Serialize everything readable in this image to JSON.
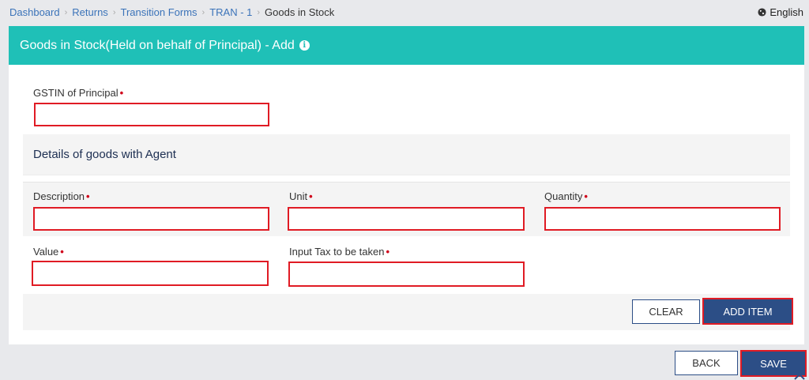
{
  "breadcrumb": {
    "items": [
      "Dashboard",
      "Returns",
      "Transition Forms",
      "TRAN - 1"
    ],
    "current": "Goods in Stock"
  },
  "language": "English",
  "card": {
    "title": "Goods in Stock(Held on behalf of Principal) - Add"
  },
  "gstin": {
    "label": "GSTIN of Principal",
    "value": "",
    "placeholder": ""
  },
  "section": {
    "title": "Details of goods with Agent"
  },
  "fields": {
    "description": {
      "label": "Description",
      "value": ""
    },
    "unit": {
      "label": "Unit",
      "value": ""
    },
    "quantity": {
      "label": "Quantity",
      "value": ""
    },
    "value": {
      "label": "Value",
      "value": ""
    },
    "input_tax": {
      "label": "Input Tax to be taken",
      "value": ""
    }
  },
  "required_marker": "•",
  "buttons": {
    "clear": "CLEAR",
    "add_item": "ADD ITEM",
    "back": "BACK",
    "save": "SAVE"
  },
  "colors": {
    "header_bg": "#1fc0b7",
    "primary_btn": "#2c4e86",
    "highlight_border": "#e01b24",
    "link": "#3b73b9"
  },
  "icons": {
    "globe": "globe-icon",
    "info": "info-icon",
    "chevron": "chevron-right-icon"
  }
}
